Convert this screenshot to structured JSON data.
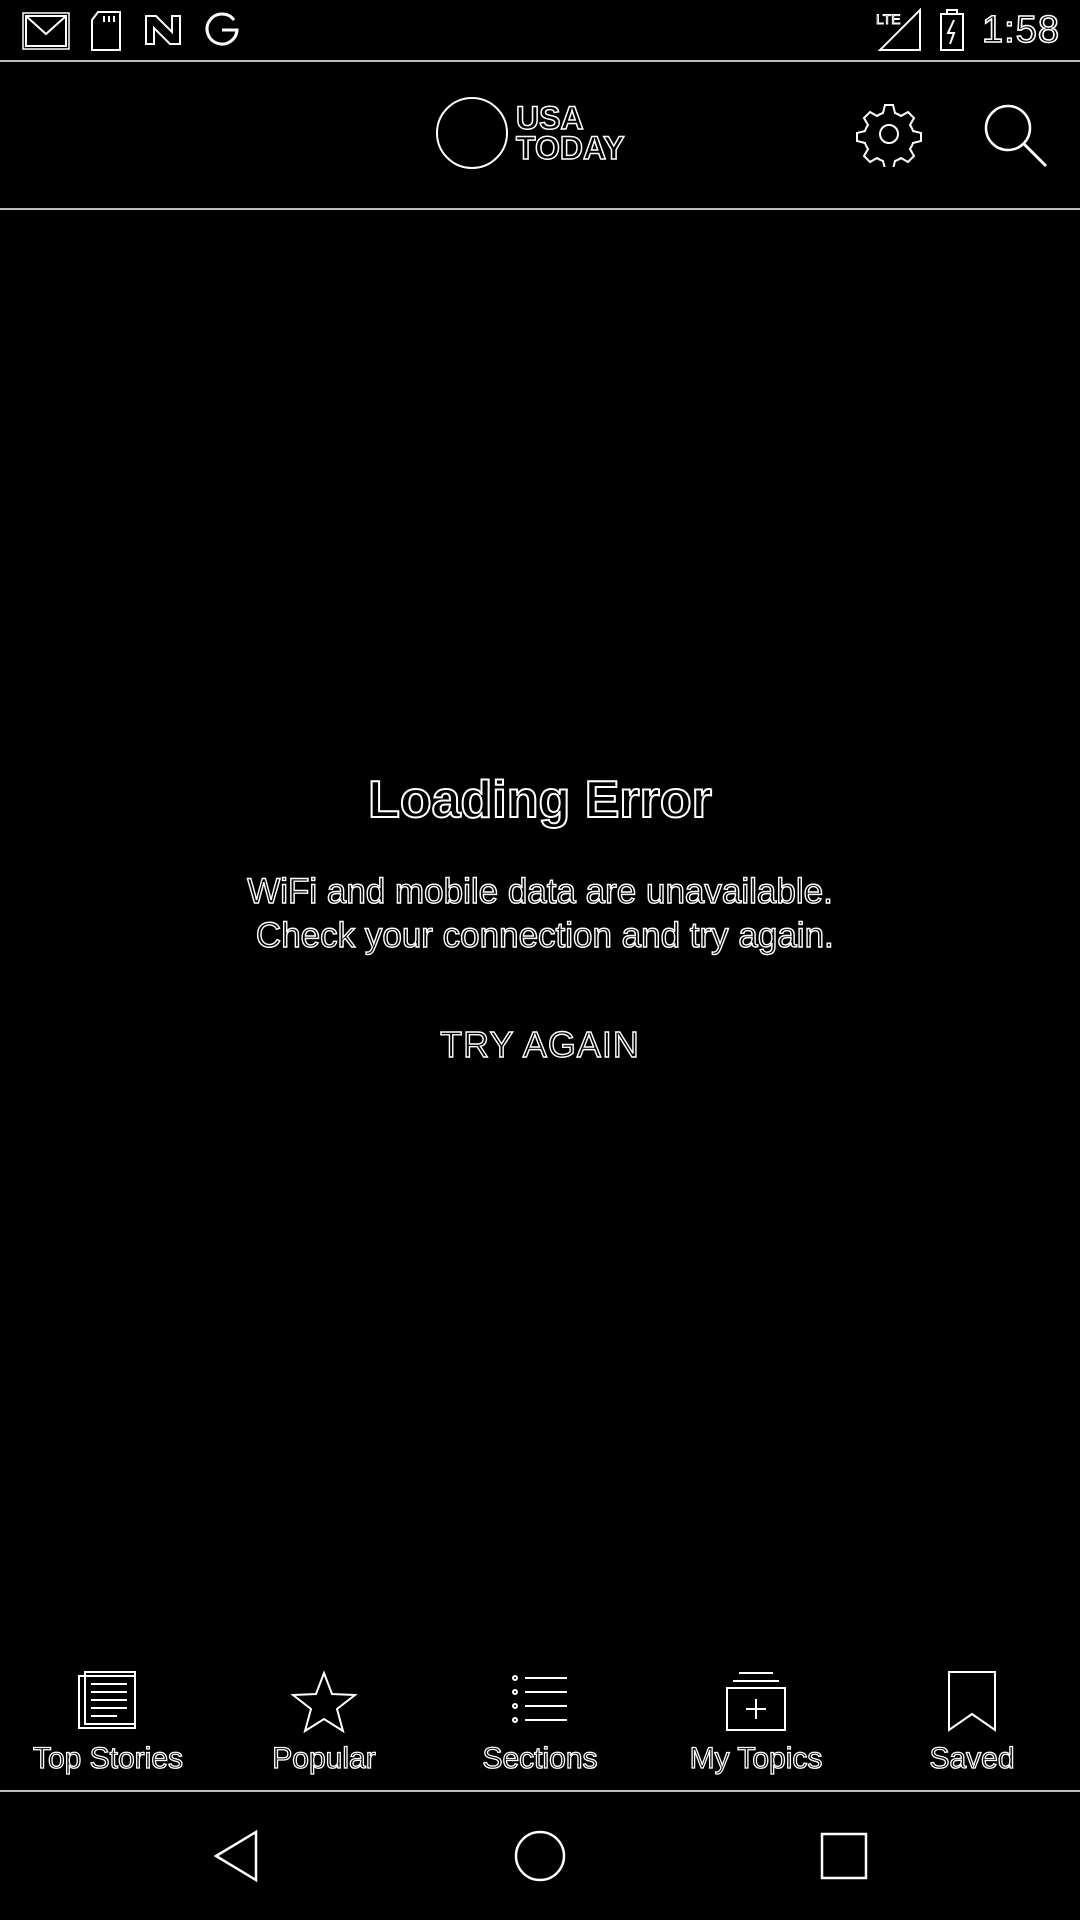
{
  "status_bar": {
    "time": "1:58",
    "left_icons": [
      "gmail-icon",
      "sd-card-icon",
      "n-news-icon",
      "google-icon"
    ],
    "right_icons": [
      "lte-signal-icon",
      "battery-charging-icon"
    ]
  },
  "app_bar": {
    "logo_line1": "USA",
    "logo_line2": "TODAY",
    "settings_icon": "gear-icon",
    "search_icon": "search-icon"
  },
  "error": {
    "title": "Loading Error",
    "message_line1": "WiFi and mobile data are unavailable.",
    "message_line2": " Check your connection and try again.",
    "action": "TRY AGAIN"
  },
  "bottom_nav": {
    "items": [
      {
        "label": "Top Stories",
        "icon": "newspaper-icon"
      },
      {
        "label": "Popular",
        "icon": "star-icon"
      },
      {
        "label": "Sections",
        "icon": "list-icon"
      },
      {
        "label": "My Topics",
        "icon": "topics-add-icon"
      },
      {
        "label": "Saved",
        "icon": "bookmark-icon"
      }
    ]
  },
  "system_nav": {
    "back": "back-triangle-icon",
    "home": "home-circle-icon",
    "recents": "recents-square-icon"
  }
}
